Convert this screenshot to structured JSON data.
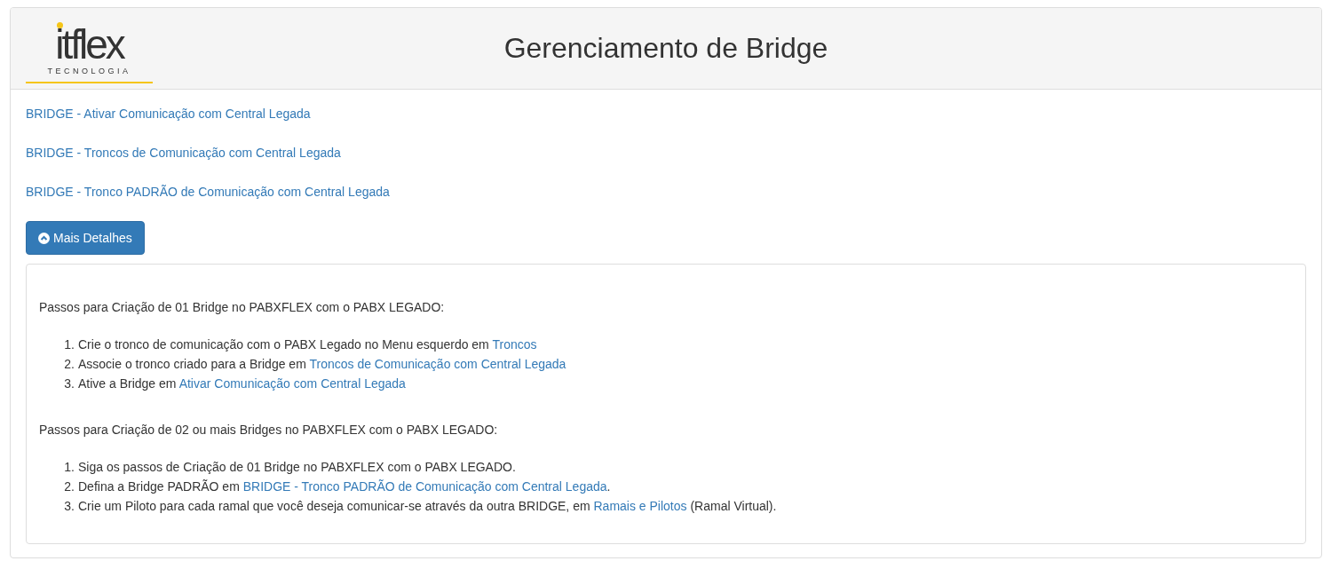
{
  "logo": {
    "name": "itflex",
    "tagline": "TECNOLOGIA"
  },
  "title": "Gerenciamento de Bridge",
  "links": [
    "BRIDGE - Ativar Comunicação com Central Legada",
    "BRIDGE - Troncos de Comunicação com Central Legada",
    "BRIDGE - Tronco PADRÃO de Comunicação com Central Legada"
  ],
  "details_button": {
    "label": "Mais Detalhes",
    "expanded": true
  },
  "details": [
    {
      "heading": "Passos para Criação de 01 Bridge no PABXFLEX com o PABX LEGADO:",
      "steps": [
        {
          "number": "1.",
          "text": "Crie o tronco de comunicação com o PABX Legado no Menu esquerdo em ",
          "link": "Troncos"
        },
        {
          "number": "2.",
          "text": "Associe o tronco criado para a Bridge em ",
          "link": "Troncos de Comunicação com Central Legada"
        },
        {
          "number": "3.",
          "text": "Ative a Bridge em ",
          "link": "Ativar Comunicação com Central Legada"
        }
      ]
    },
    {
      "heading": "Passos para Criação de 02 ou mais Bridges no PABXFLEX com o PABX LEGADO:",
      "steps": [
        {
          "number": "1.",
          "text": "Siga os passos de Criação de 01 Bridge no PABXFLEX com o PABX LEGADO."
        },
        {
          "number": "2.",
          "text": "Defina a Bridge PADRÃO em ",
          "link": "BRIDGE - Tronco PADRÃO de Comunicação com Central Legada",
          "after": "."
        },
        {
          "number": "3.",
          "text": "Crie um Piloto para cada ramal que você deseja comunicar-se através da outra BRIDGE, em ",
          "link": "Ramais e Pilotos",
          "after": " (Ramal Virtual)."
        }
      ]
    }
  ]
}
